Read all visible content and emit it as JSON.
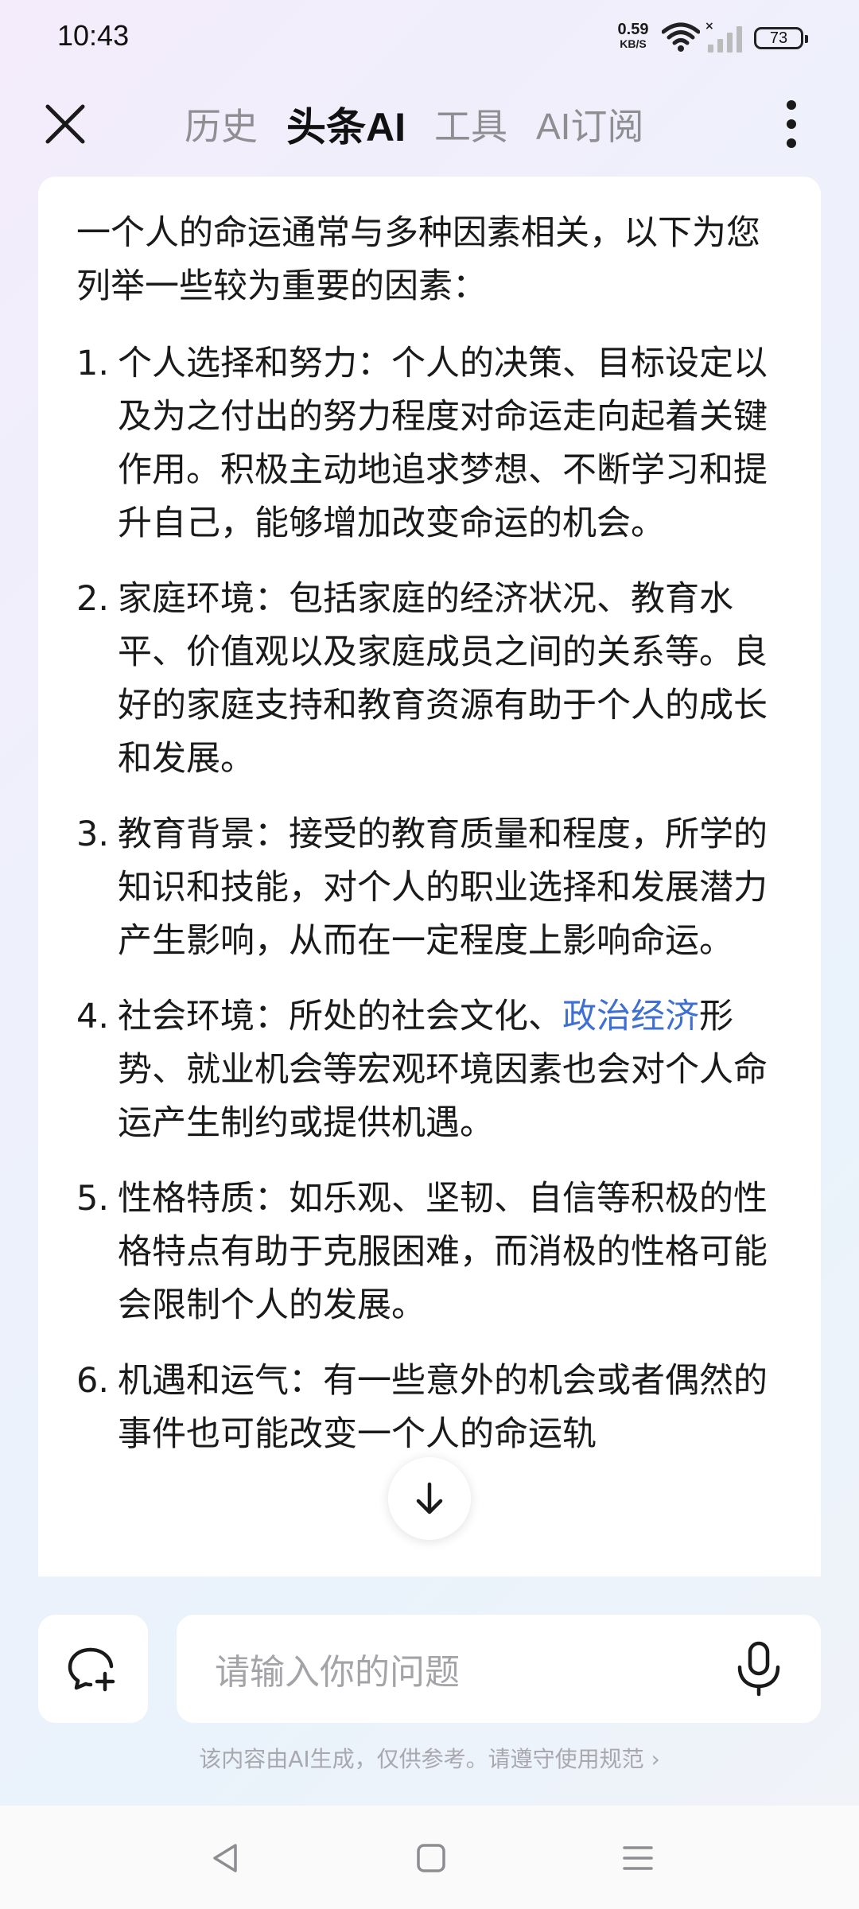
{
  "status_bar": {
    "time": "10:43",
    "net_speed_value": "0.59",
    "net_speed_unit": "KB/S",
    "battery": "73"
  },
  "nav": {
    "tabs": [
      {
        "label": "历史",
        "active": false
      },
      {
        "label": "头条AI",
        "active": true
      },
      {
        "label": "工具",
        "active": false
      },
      {
        "label": "AI订阅",
        "active": false
      }
    ]
  },
  "answer": {
    "intro": "一个人的命运通常与多种因素相关，以下为您列举一些较为重要的因素：",
    "items": [
      {
        "num": "1.",
        "text": "个人选择和努力：个人的决策、目标设定以及为之付出的努力程度对命运走向起着关键作用。积极主动地追求梦想、不断学习和提升自己，能够增加改变命运的机会。"
      },
      {
        "num": "2.",
        "text": "家庭环境：包括家庭的经济状况、教育水平、价值观以及家庭成员之间的关系等。良好的家庭支持和教育资源有助于个人的成长和发展。"
      },
      {
        "num": "3.",
        "text": "教育背景：接受的教育质量和程度，所学的知识和技能，对个人的职业选择和发展潜力产生影响，从而在一定程度上影响命运。"
      },
      {
        "num": "4.",
        "text_before": "社会环境：所处的社会文化、",
        "link": "政治经济",
        "text_after": "形势、就业机会等宏观环境因素也会对个人命运产生制约或提供机遇。"
      },
      {
        "num": "5.",
        "text": "性格特质：如乐观、坚韧、自信等积极的性格特点有助于克服困难，而消极的性格可能会限制个人的发展。"
      },
      {
        "num": "6.",
        "text": "机遇和运气：有一些意外的机会或者偶然的事件也可能改变一个人的命运轨"
      }
    ],
    "link_color": "#3e6fd1"
  },
  "input": {
    "placeholder": "请输入你的问题"
  },
  "footer": {
    "disclaimer": "该内容由AI生成，仅供参考。请遵守使用规范",
    "chevron": "›"
  },
  "icons": {
    "close": "close-icon",
    "more": "more-vertical-icon",
    "scroll_down": "arrow-down-icon",
    "new_chat": "chat-plus-icon",
    "mic": "microphone-icon",
    "back": "back-triangle-icon",
    "home": "home-square-icon",
    "recents": "menu-lines-icon"
  }
}
